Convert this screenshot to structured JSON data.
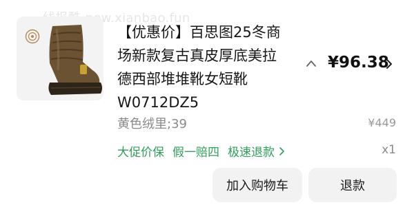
{
  "watermark": "线报酷-new.xianbao.fun",
  "product": {
    "title_lines": [
      "【优惠价】百思图25冬商",
      "场新款复古真皮厚底美拉",
      "德西部堆堆靴女短靴",
      "W0712DZ5"
    ],
    "price": "¥96.38",
    "original_price": "¥449",
    "spec": "黄色绒里;39",
    "quantity": "x1",
    "image_icon": "boot-image",
    "brand_mark_icon": "brand-logo-icon"
  },
  "services": [
    "大促价保",
    "假一赔四",
    "极速退款"
  ],
  "actions": {
    "add_to_cart": "加入购物车",
    "refund": "退款"
  },
  "colors": {
    "service_green": "#2f9e5a",
    "button_bg": "#f2f2f2",
    "thumb_bg": "#f3f3f3",
    "muted_text": "#8a8a8a"
  }
}
